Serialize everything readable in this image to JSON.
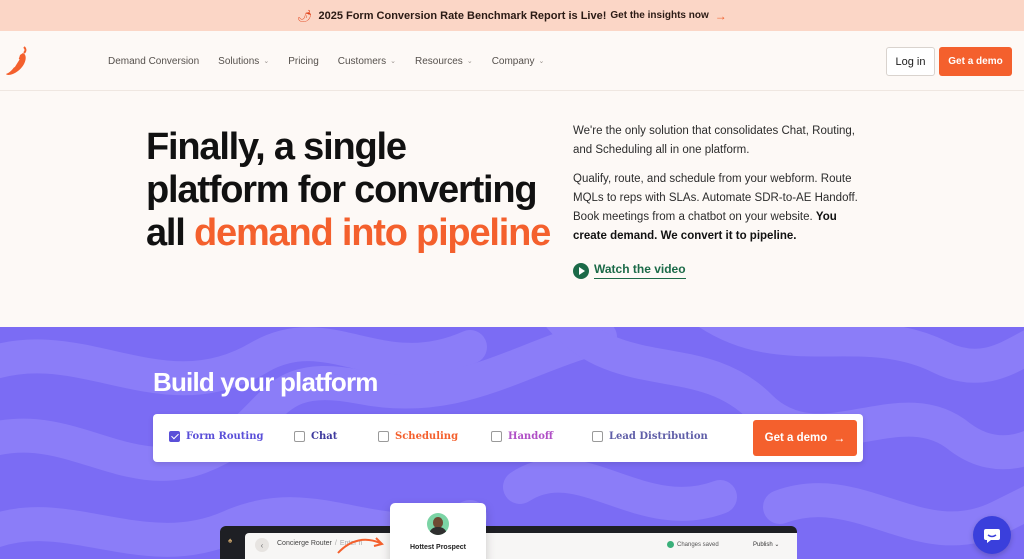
{
  "announcement": {
    "text": "2025 Form Conversion Rate Benchmark Report is Live!",
    "link": "Get the insights now"
  },
  "nav": {
    "items": [
      {
        "label": "Demand Conversion",
        "dropdown": false
      },
      {
        "label": "Solutions",
        "dropdown": true
      },
      {
        "label": "Pricing",
        "dropdown": false
      },
      {
        "label": "Customers",
        "dropdown": true
      },
      {
        "label": "Resources",
        "dropdown": true
      },
      {
        "label": "Company",
        "dropdown": true
      }
    ],
    "login_label": "Log in",
    "demo_label": "Get a demo"
  },
  "hero": {
    "title_line1": "Finally, a single",
    "title_line2": "platform for converting",
    "title_line3_plain": "all",
    "title_line3_accent": "demand into pipeline",
    "para1": "We're the only solution that consolidates Chat, Routing, and Scheduling all in one platform.",
    "para2_plain": "Qualify, route, and schedule from your webform. Route MQLs to reps with SLAs. Automate SDR-to-AE Handoff. Book meetings from a chatbot on your website.",
    "para2_bold": "You create demand. We convert it to pipeline.",
    "watch_label": "Watch the video"
  },
  "build": {
    "title": "Build your platform",
    "options": [
      {
        "label": "Form Routing",
        "checked": true,
        "color": "#5a4fd8"
      },
      {
        "label": "Chat",
        "checked": false,
        "color": "#3e3a9e"
      },
      {
        "label": "Scheduling",
        "checked": false,
        "color": "#f4602d"
      },
      {
        "label": "Handoff",
        "checked": false,
        "color": "#b04fc6"
      },
      {
        "label": "Lead Distribution",
        "checked": false,
        "color": "#5f5ea8"
      }
    ],
    "demo_label": "Get a demo"
  },
  "preview": {
    "breadcrumb": "Concierge Router",
    "placeholder": "Enter n",
    "prospect_label": "Hottest Prospect",
    "saved_label": "Changes saved",
    "publish_label": "Publish"
  },
  "colors": {
    "accent": "#f4602d",
    "purple": "#7b6cf4",
    "green": "#1b6a48"
  }
}
